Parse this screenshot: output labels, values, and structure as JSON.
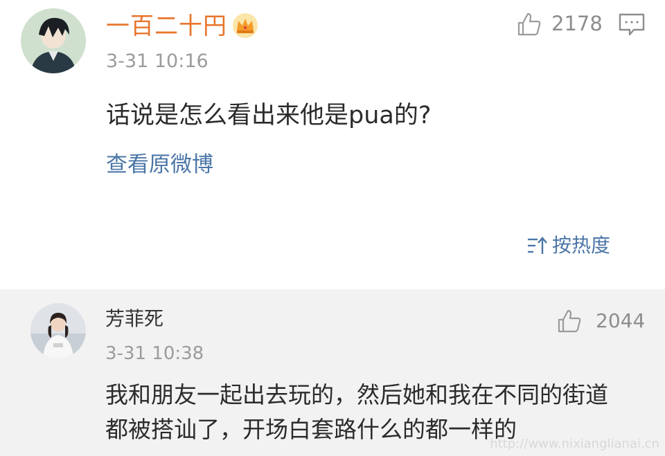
{
  "comment": {
    "username": "一百二十円",
    "badge_icon": "crown-icon",
    "time": "3-31 10:16",
    "like_count": "2178",
    "text": "话说是怎么看出来他是pua的?",
    "view_original": "查看原微博"
  },
  "sort": {
    "label": "按热度",
    "icon": "sort-icon"
  },
  "reply": {
    "username": "芳菲死",
    "time": "3-31 10:38",
    "like_count": "2044",
    "text_lines": [
      "我和朋友一起出去玩的，然后她和我在不同的街道",
      "都被搭讪了，开场白套路什么的都一样的"
    ]
  },
  "watermark": "http://www.nixianglianai.cn",
  "colors": {
    "username_accent": "#e8762c",
    "link": "#4b76a7",
    "reply_background": "#f2f2f2",
    "meta_gray": "#9b9b9b"
  }
}
